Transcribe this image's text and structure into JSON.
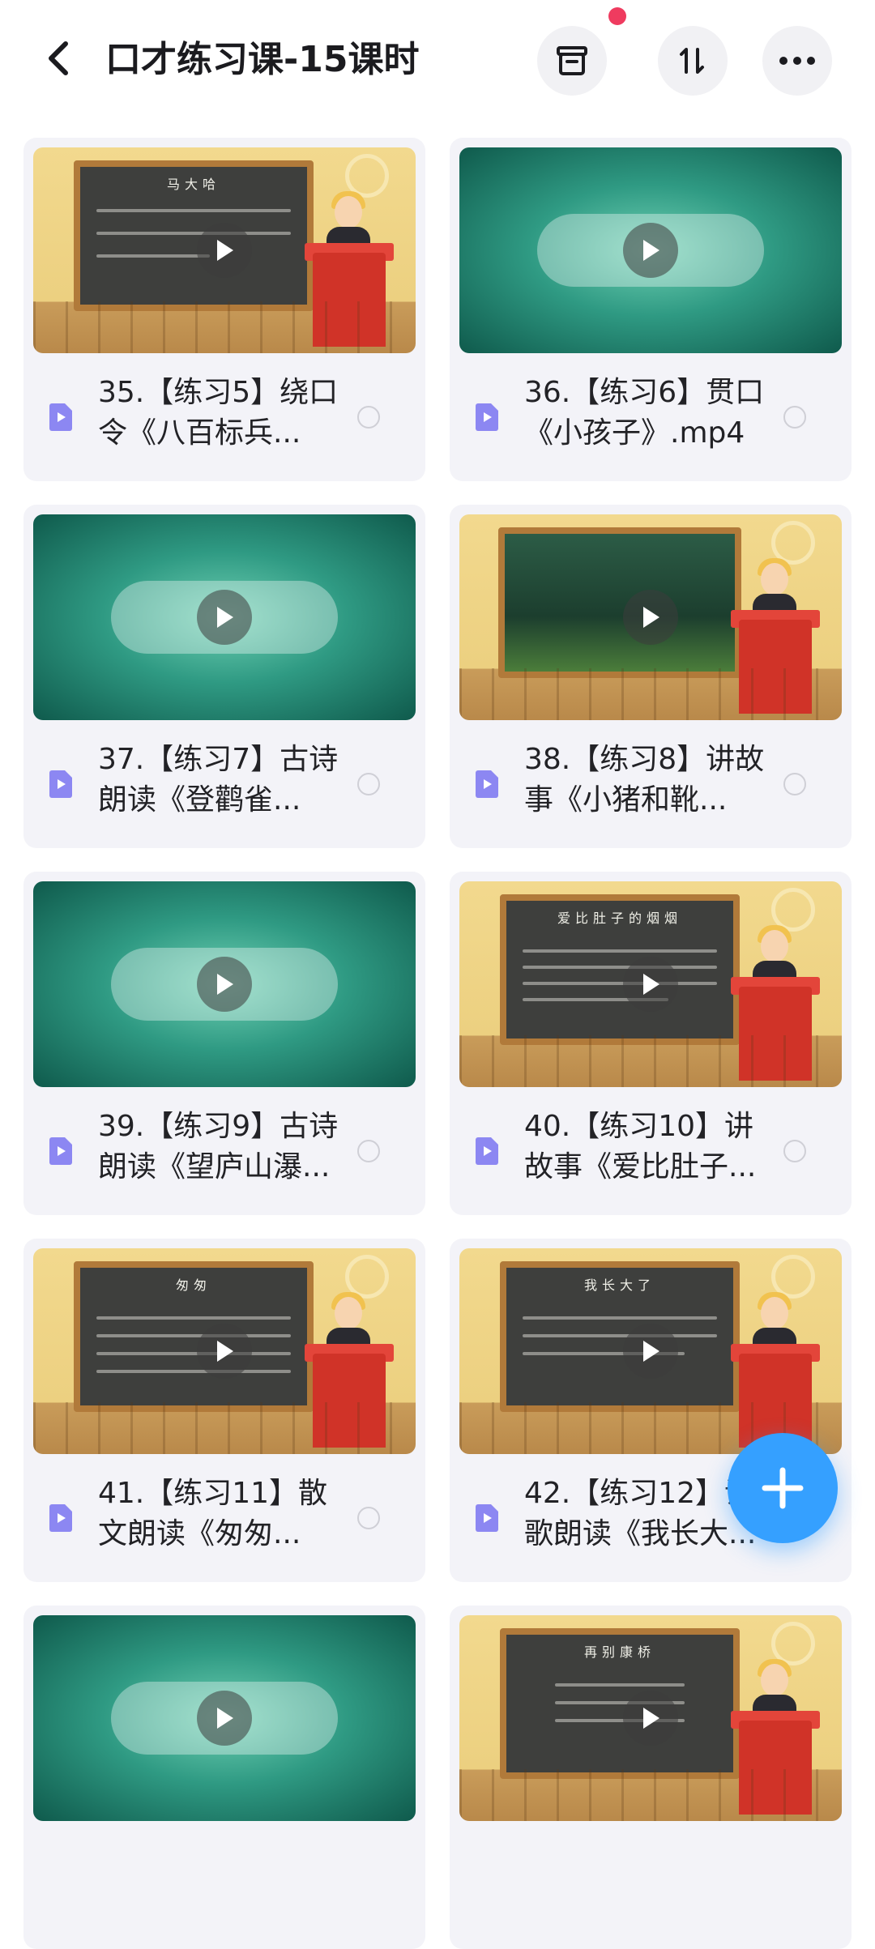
{
  "header": {
    "title": "口才练习课-15课时",
    "back_icon": "chevron-left-icon",
    "actions": [
      {
        "name": "archive-button",
        "icon": "archive-icon"
      },
      {
        "name": "sort-button",
        "icon": "sort-icon"
      },
      {
        "name": "more-button",
        "icon": "more-horizontal-icon"
      }
    ],
    "notification_color": "#ef3b5f"
  },
  "items": [
    {
      "label": "35.【练习5】绕口令《八百标兵...",
      "thumb": "classroom",
      "board_title": "马大哈"
    },
    {
      "label": "36.【练习6】贯口《小孩子》.mp4",
      "thumb": "green"
    },
    {
      "label": "37.【练习7】古诗朗读《登鹳雀...",
      "thumb": "green"
    },
    {
      "label": "38.【练习8】讲故事《小猪和靴...",
      "thumb": "scene"
    },
    {
      "label": "39.【练习9】古诗朗读《望庐山瀑...",
      "thumb": "green"
    },
    {
      "label": "40.【练习10】讲故事《爱比肚子...",
      "thumb": "classroom",
      "board_title": "爱比肚子的烟烟"
    },
    {
      "label": "41.【练习11】散文朗读《匆匆...",
      "thumb": "classroom",
      "board_title": "匆匆"
    },
    {
      "label": "42.【练习12】诗歌朗读《我长大...",
      "thumb": "classroom",
      "board_title": "我长大了"
    },
    {
      "label": "",
      "thumb": "green"
    },
    {
      "label": "",
      "thumb": "classroom",
      "board_title": "再别康桥"
    }
  ],
  "colors": {
    "card_bg": "#f3f3f8",
    "file_icon": "#8c87f2",
    "fab": "#35a0ff"
  }
}
